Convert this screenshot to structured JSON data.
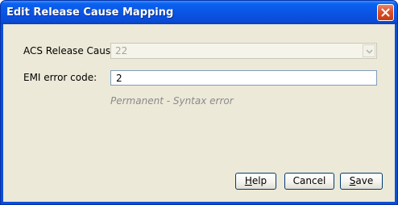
{
  "window": {
    "title": "Edit Release Cause Mapping"
  },
  "form": {
    "acs_release_cause": {
      "label": "ACS Release Cause:",
      "value": "22",
      "enabled": false
    },
    "emi_error_code": {
      "label": "EMI error code:",
      "value": "2"
    },
    "description": "Permanent - Syntax error"
  },
  "buttons": {
    "help": {
      "mnemonic": "H",
      "rest": "elp"
    },
    "cancel": {
      "label": "Cancel"
    },
    "save": {
      "mnemonic": "S",
      "rest": "ave"
    }
  },
  "icons": {
    "close": "close-icon",
    "dropdown": "chevron-down-icon"
  },
  "colors": {
    "titlebar": "#0a55e4",
    "close_button": "#d9512c",
    "client_background": "#ece9d8",
    "hint_text": "#8a8a8a"
  }
}
